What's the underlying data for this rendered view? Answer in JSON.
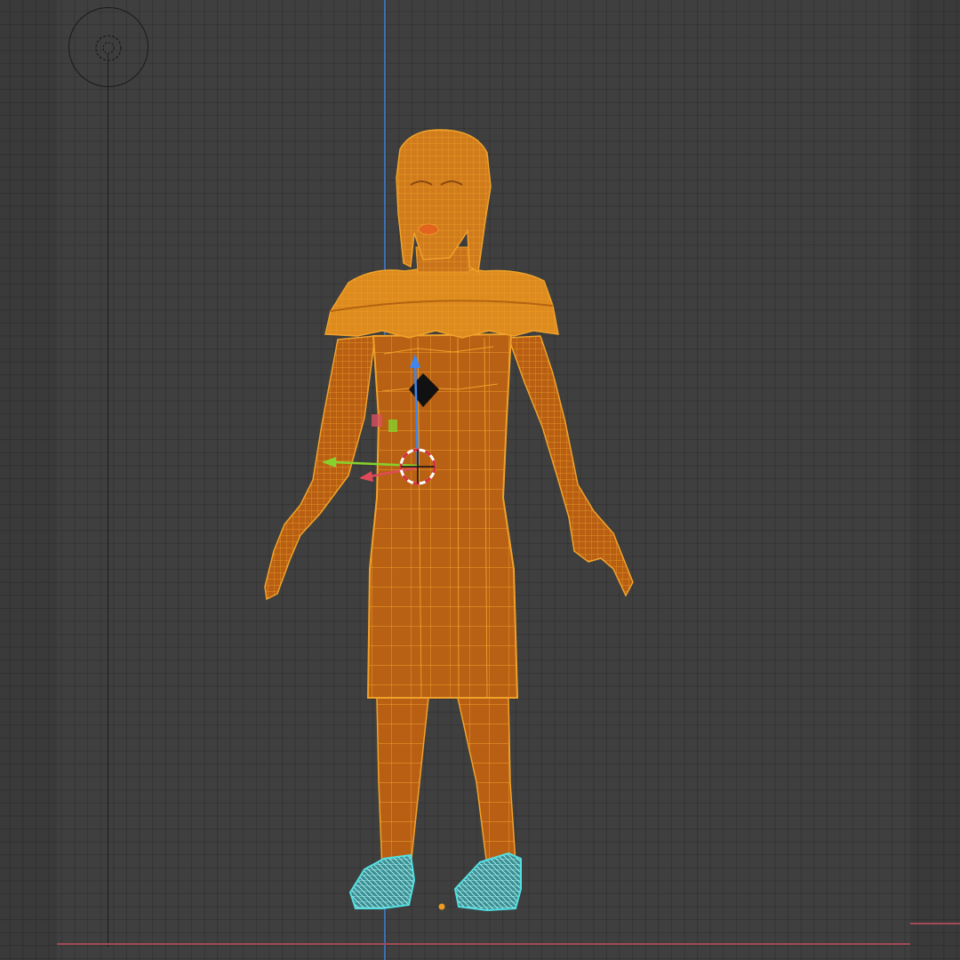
{
  "viewport": {
    "editor": "3d-viewport",
    "mode": "wireframe",
    "colors": {
      "background": "#3f3f3f",
      "mesh_selected": "#e2861a",
      "wire": "#f0a22a",
      "shoes_active": "#52e0e2",
      "x_axis": "#a24a55",
      "z_axis": "#3d6fb3",
      "gizmo_x": "#e04a58",
      "gizmo_y": "#86d22c",
      "gizmo_z": "#3f86ee"
    }
  },
  "icons": {
    "navigation_gizmo": "view-navigation-icon",
    "cursor": "3d-cursor-icon",
    "origin": "object-origin-icon"
  }
}
